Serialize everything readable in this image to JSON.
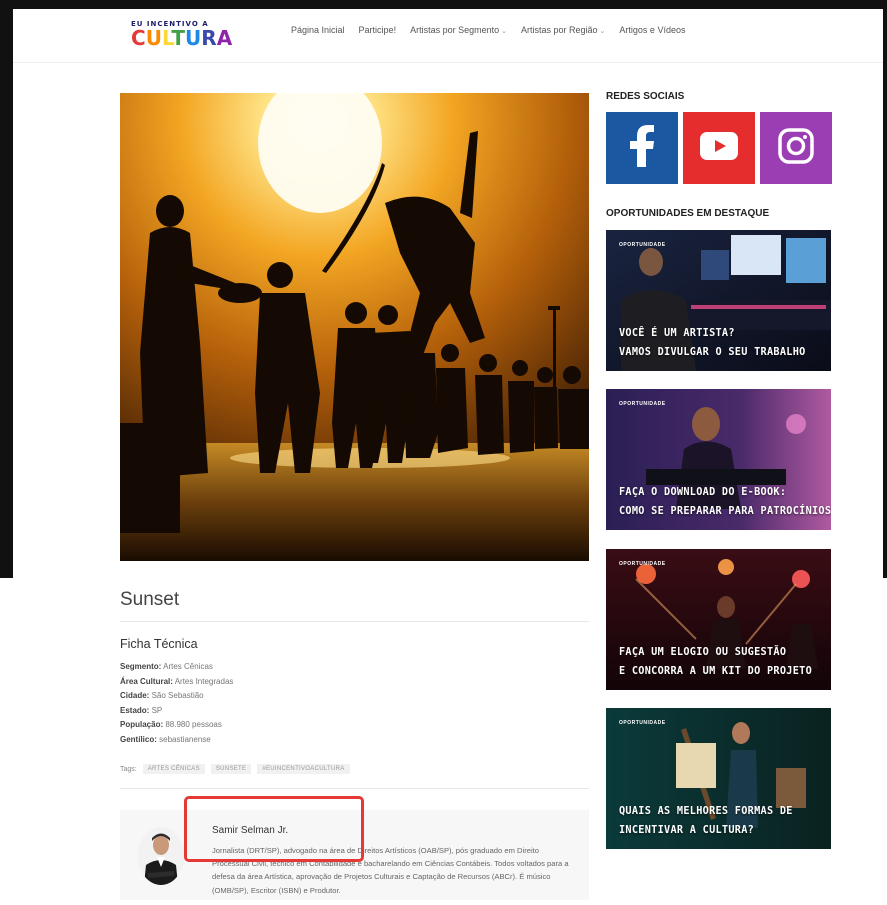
{
  "logo": {
    "line1": "EU INCENTIVO A",
    "line2_letters": [
      "C",
      "U",
      "L",
      "T",
      "U",
      "R",
      "A"
    ]
  },
  "nav": {
    "items": [
      {
        "label": "Página Inicial",
        "dropdown": false
      },
      {
        "label": "Participe!",
        "dropdown": false
      },
      {
        "label": "Artistas por Segmento",
        "dropdown": true
      },
      {
        "label": "Artistas por Região",
        "dropdown": true
      },
      {
        "label": "Artigos e Vídeos",
        "dropdown": false
      }
    ],
    "caret": "⌄"
  },
  "article": {
    "title": "Sunset",
    "ficha_title": "Ficha Técnica",
    "ficha": [
      {
        "key": "Segmento:",
        "value": "Artes Cênicas"
      },
      {
        "key": "Área Cultural:",
        "value": "Artes Integradas"
      },
      {
        "key": "Cidade:",
        "value": "São Sebastião"
      },
      {
        "key": "Estado:",
        "value": "SP"
      },
      {
        "key": "População:",
        "value": "88.980 pessoas"
      },
      {
        "key": "Gentílico:",
        "value": "sebastianense"
      }
    ],
    "tags_label": "Tags:",
    "tags": [
      "ARTES CÊNICAS",
      "SUNSETE",
      "#EUINCENTIVOACULTURA"
    ]
  },
  "author": {
    "name": "Samir Selman Jr.",
    "bio": "Jornalista (DRT/SP), advogado na área de Direitos Artísticos (OAB/SP), pós graduado em Direito Processual Civil, técnico em Contabilidade e bacharelando em Ciências Contábeis. Todos voltados para a defesa da área Artística, aprovação de Projetos Culturais e Captação de Recursos (ABCr). É músico (OMB/SP), Escritor (ISBN) e Produtor."
  },
  "sidebar": {
    "social_heading": "REDES SOCIAIS",
    "social": [
      {
        "name": "facebook",
        "color": "#1c57a1"
      },
      {
        "name": "youtube",
        "color": "#e62d2d"
      },
      {
        "name": "instagram",
        "color": "#9b3db3"
      }
    ],
    "opps_heading": "OPORTUNIDADES EM DESTAQUE",
    "opps": [
      {
        "kicker": "OPORTUNIDADE",
        "line1": "VOCÊ É UM ARTISTA?",
        "line2": "VAMOS DIVULGAR O SEU TRABALHO"
      },
      {
        "kicker": "OPORTUNIDADE",
        "line1": "FAÇA O DOWNLOAD DO E-BOOK:",
        "line2": "COMO SE PREPARAR PARA PATROCÍNIOS?"
      },
      {
        "kicker": "OPORTUNIDADE",
        "line1": "FAÇA UM ELOGIO OU SUGESTÃO",
        "line2": "E CONCORRA A UM KIT DO PROJETO"
      },
      {
        "kicker": "OPORTUNIDADE",
        "line1": "QUAIS AS MELHORES FORMAS DE",
        "line2": "INCENTIVAR A CULTURA?"
      }
    ]
  },
  "colors": {
    "highlight": "#e53935",
    "facebook": "#1c57a1",
    "youtube": "#e62d2d",
    "instagram": "#9b3db3"
  }
}
